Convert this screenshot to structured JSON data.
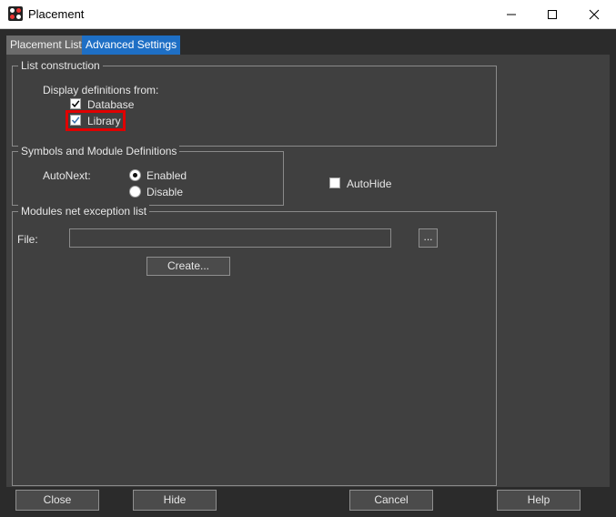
{
  "window": {
    "title": "Placement"
  },
  "tabs": [
    {
      "label": "Placement List",
      "active": false
    },
    {
      "label": "Advanced Settings",
      "active": true
    }
  ],
  "list_construction": {
    "title": "List construction",
    "display_from_label": "Display definitions from:",
    "options": [
      {
        "label": "Database",
        "checked": true
      },
      {
        "label": "Library",
        "checked": true
      }
    ]
  },
  "symbols_module": {
    "title": "Symbols and Module Definitions",
    "autonext_label": "AutoNext:",
    "options": [
      {
        "label": "Enabled",
        "selected": true
      },
      {
        "label": "Disable",
        "selected": false
      }
    ]
  },
  "autohide": {
    "label": "AutoHide",
    "checked": false
  },
  "modules_net": {
    "title": "Modules net exception list",
    "file_label": "File:",
    "file_value": "",
    "browse_label": "...",
    "create_label": "Create..."
  },
  "footer": {
    "close_label": "Close",
    "hide_label": "Hide",
    "cancel_label": "Cancel",
    "help_label": "Help"
  },
  "colors": {
    "accent_tab": "#1e6fc5",
    "highlight": "#e00000",
    "panel_bg": "#404040"
  }
}
